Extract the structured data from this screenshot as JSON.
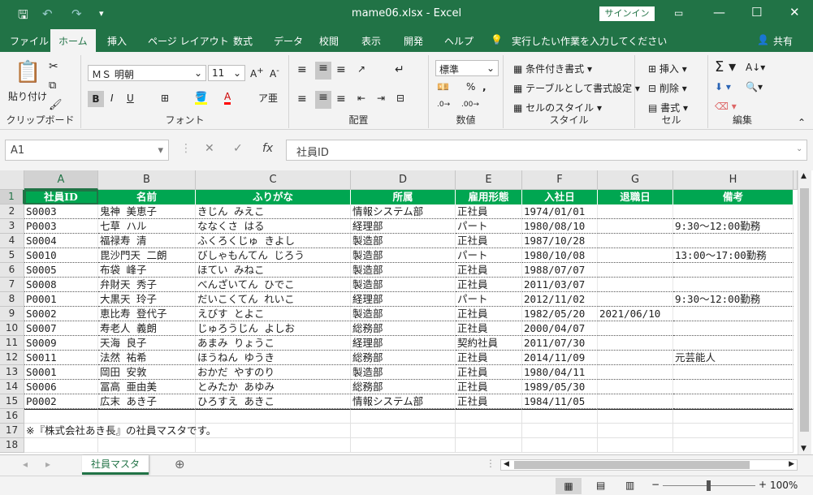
{
  "title_bar": {
    "title": "mame06.xlsx - Excel",
    "signin_label": "サインイン"
  },
  "ribbon_tabs": [
    "ファイル",
    "ホーム",
    "挿入",
    "ページ レイアウト",
    "数式",
    "データ",
    "校閲",
    "表示",
    "開発",
    "ヘルプ"
  ],
  "tell_me": "実行したい作業を入力してください",
  "share_label": "共有",
  "ribbon": {
    "clipboard": {
      "paste": "貼り付け",
      "label": "クリップボード"
    },
    "font": {
      "name": "ＭＳ 明朝",
      "size": "11",
      "label": "フォント",
      "bold": "B",
      "italic": "I",
      "underline": "U"
    },
    "alignment": {
      "label": "配置"
    },
    "number": {
      "format": "標準",
      "label": "数値"
    },
    "styles": {
      "cond": "条件付き書式",
      "table": "テーブルとして書式設定",
      "cell": "セルのスタイル",
      "label": "スタイル"
    },
    "cells": {
      "insert": "挿入",
      "delete": "削除",
      "format": "書式",
      "label": "セル"
    },
    "editing": {
      "label": "編集"
    }
  },
  "formula_bar": {
    "name_box": "A1",
    "content": "社員ID"
  },
  "columns": [
    "A",
    "B",
    "C",
    "D",
    "E",
    "F",
    "G",
    "H"
  ],
  "rows": [
    "1",
    "2",
    "3",
    "4",
    "5",
    "6",
    "7",
    "8",
    "9",
    "10",
    "11",
    "12",
    "13",
    "14",
    "15",
    "16",
    "17",
    "18"
  ],
  "table": {
    "headers": [
      "社員ID",
      "名前",
      "ふりがな",
      "所属",
      "雇用形態",
      "入社日",
      "退職日",
      "備考"
    ],
    "data": [
      [
        "S0003",
        "鬼神 美恵子",
        "きじん みえこ",
        "情報システム部",
        "正社員",
        "1974/01/01",
        "",
        ""
      ],
      [
        "P0003",
        "七草 ハル",
        "ななくさ はる",
        "経理部",
        "パート",
        "1980/08/10",
        "",
        "9:30～12:00勤務"
      ],
      [
        "S0004",
        "福禄寿 清",
        "ふくろくじゅ きよし",
        "製造部",
        "正社員",
        "1987/10/28",
        "",
        ""
      ],
      [
        "S0010",
        "毘沙門天 二朗",
        "びしゃもんてん じろう",
        "製造部",
        "パート",
        "1980/10/08",
        "",
        "13:00～17:00勤務"
      ],
      [
        "S0005",
        "布袋 峰子",
        "ほてい みねこ",
        "製造部",
        "正社員",
        "1988/07/07",
        "",
        ""
      ],
      [
        "S0008",
        "弁財天 秀子",
        "べんざいてん ひでこ",
        "製造部",
        "正社員",
        "2011/03/07",
        "",
        ""
      ],
      [
        "P0001",
        "大黒天 玲子",
        "だいこくてん れいこ",
        "経理部",
        "パート",
        "2012/11/02",
        "",
        "9:30～12:00勤務"
      ],
      [
        "S0002",
        "恵比寿 登代子",
        "えびす とよこ",
        "製造部",
        "正社員",
        "1982/05/20",
        "2021/06/10",
        ""
      ],
      [
        "S0007",
        "寿老人 義朗",
        "じゅろうじん よしお",
        "総務部",
        "正社員",
        "2000/04/07",
        "",
        ""
      ],
      [
        "S0009",
        "天海 良子",
        "あまみ りょうこ",
        "経理部",
        "契約社員",
        "2011/07/30",
        "",
        ""
      ],
      [
        "S0011",
        "法然 祐希",
        "ほうねん ゆうき",
        "総務部",
        "正社員",
        "2014/11/09",
        "",
        "元芸能人"
      ],
      [
        "S0001",
        "岡田 安敦",
        "おかだ やすのり",
        "製造部",
        "正社員",
        "1980/04/11",
        "",
        ""
      ],
      [
        "S0006",
        "冨高 亜由美",
        "とみたか あゆみ",
        "総務部",
        "正社員",
        "1989/05/30",
        "",
        ""
      ],
      [
        "P0002",
        "広末 あき子",
        "ひろすえ あきこ",
        "情報システム部",
        "正社員",
        "1984/11/05",
        "",
        ""
      ]
    ],
    "note": "※『株式会社あき長』の社員マスタです。"
  },
  "sheet_tab": "社員マスタ",
  "zoom": "100%",
  "accent": "#217346",
  "header_fill": "#00a651"
}
